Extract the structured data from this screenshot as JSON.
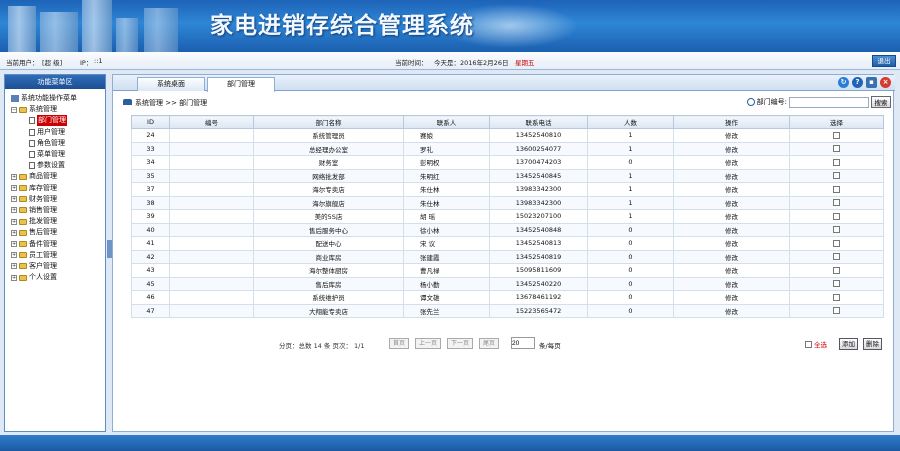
{
  "banner": {
    "title": "家电进销存综合管理系统"
  },
  "status": {
    "user_label": "当前用户：",
    "user_value": "[超 级]",
    "ip_label": "IP：",
    "ip_value": "::1",
    "time_label": "当前时间：",
    "time_value": "今天是：2016年2月26日",
    "weekday": "星期五",
    "logout": "退出"
  },
  "sidebar": {
    "title": "功能菜单区",
    "root": "系统功能操作菜单",
    "items": [
      {
        "label": "系统管理",
        "expanded": true,
        "children": [
          "部门管理",
          "用户管理",
          "角色管理",
          "菜单管理",
          "参数设置"
        ]
      },
      {
        "label": "商品管理"
      },
      {
        "label": "库存管理"
      },
      {
        "label": "财务管理"
      },
      {
        "label": "销售管理"
      },
      {
        "label": "批发管理"
      },
      {
        "label": "售后管理"
      },
      {
        "label": "备件管理"
      },
      {
        "label": "员工管理"
      },
      {
        "label": "客户管理"
      },
      {
        "label": "个人设置"
      }
    ]
  },
  "tabs": [
    "系统桌面",
    "部门管理"
  ],
  "breadcrumb": "系统管理 >> 部门管理",
  "search": {
    "label": "部门编号:",
    "button": "搜索",
    "value": ""
  },
  "table": {
    "headers": [
      "ID",
      "编号",
      "部门名称",
      "联系人",
      "联系电话",
      "人数",
      "操作",
      "选择"
    ],
    "rows": [
      [
        "24",
        "",
        "系统管理员",
        "赛娘",
        "13452540810",
        "1",
        "修改"
      ],
      [
        "33",
        "",
        "总经理办公室",
        "罗礼",
        "13600254077",
        "1",
        "修改"
      ],
      [
        "34",
        "",
        "财务室",
        "彭明权",
        "13700474203",
        "0",
        "修改"
      ],
      [
        "35",
        "",
        "网络批发部",
        "朱明红",
        "13452540845",
        "1",
        "修改"
      ],
      [
        "37",
        "",
        "海尔专卖店",
        "朱仕林",
        "13983342300",
        "1",
        "修改"
      ],
      [
        "38",
        "",
        "海尔旗舰店",
        "朱仕林",
        "13983342300",
        "1",
        "修改"
      ],
      [
        "39",
        "",
        "美的5S店",
        "胡 瑶",
        "15023207100",
        "1",
        "修改"
      ],
      [
        "40",
        "",
        "售后服务中心",
        "徐小林",
        "13452540848",
        "0",
        "修改"
      ],
      [
        "41",
        "",
        "配送中心",
        "宋 议",
        "13452540813",
        "0",
        "修改"
      ],
      [
        "42",
        "",
        "商业库房",
        "张建霞",
        "13452540819",
        "0",
        "修改"
      ],
      [
        "43",
        "",
        "海尔整体厨房",
        "曹凡禄",
        "15095811609",
        "0",
        "修改"
      ],
      [
        "45",
        "",
        "售后库房",
        "杨小勤",
        "13452540220",
        "0",
        "修改"
      ],
      [
        "46",
        "",
        "系统维护员",
        "谭文雄",
        "13678461192",
        "0",
        "修改"
      ],
      [
        "47",
        "",
        "大翔能专卖店",
        "张先兰",
        "15223565472",
        "0",
        "修改"
      ]
    ]
  },
  "pager": {
    "info": "分页：总数 14 条  页次： 1/1",
    "first": "首页",
    "prev": "上一页",
    "next": "下一页",
    "last": "尾页",
    "page_size": "20",
    "per_page": "条/每页",
    "select_all": "全选",
    "add": "添加",
    "delete": "删除"
  }
}
